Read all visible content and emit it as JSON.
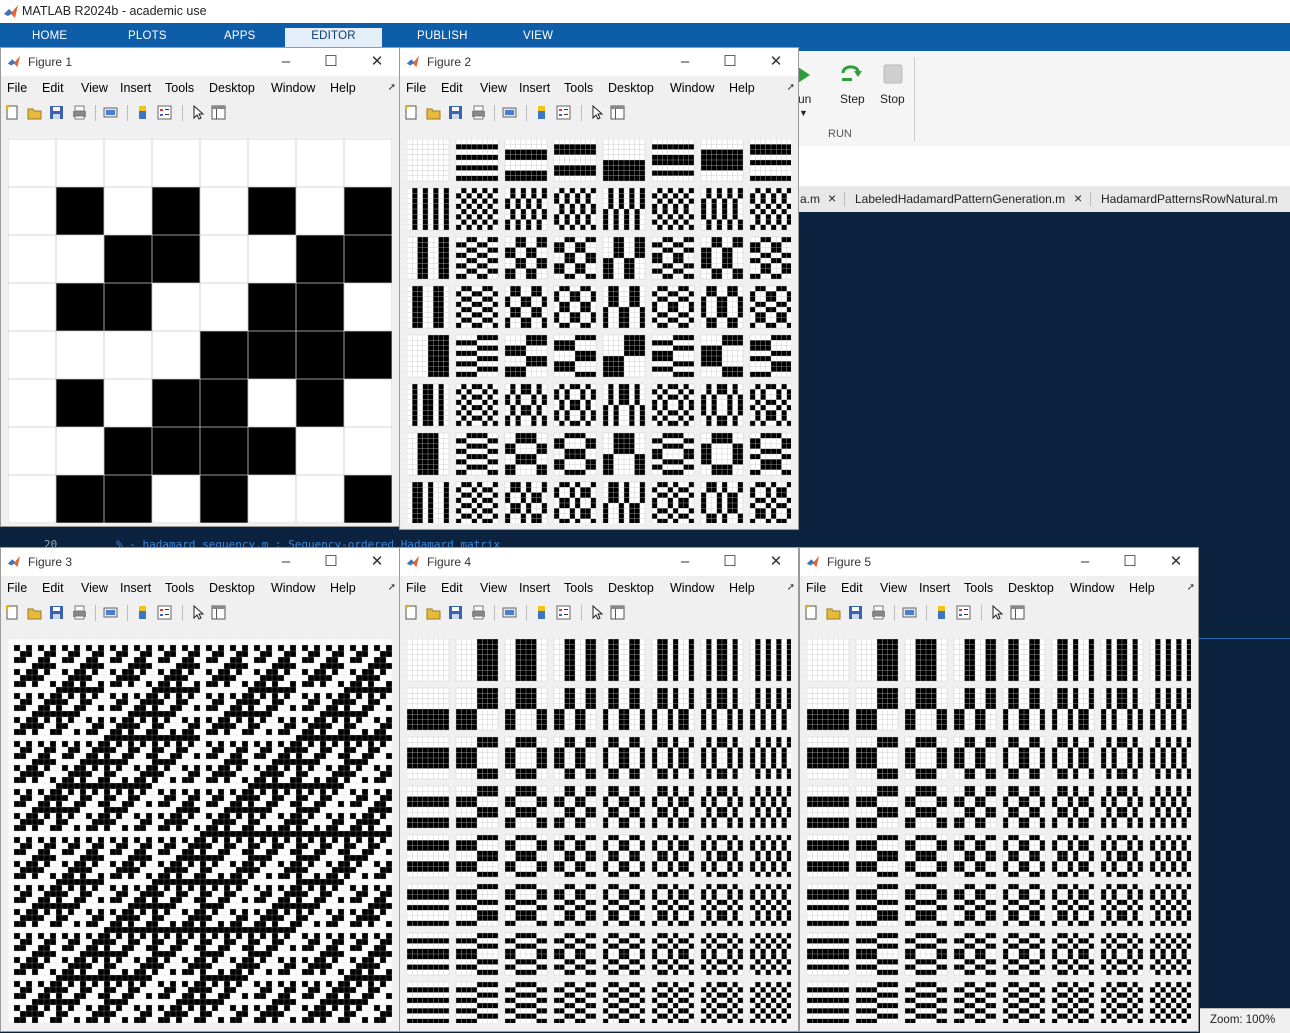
{
  "app": {
    "title": "MATLAB R2024b - academic use",
    "tabs": [
      "HOME",
      "PLOTS",
      "APPS",
      "EDITOR",
      "PUBLISH",
      "VIEW"
    ],
    "active_tab": "EDITOR"
  },
  "ribbon": {
    "run_label": "un",
    "step_label": "Step",
    "stop_label": "Stop",
    "section_label": "RUN"
  },
  "editor": {
    "file_tabs": [
      "a.m",
      "LabeledHadamardPatternGeneration.m",
      "HadamardPatternsRowNatural.m"
    ],
    "close_glyph": "×",
    "line_number": "20",
    "code_line": "%   - hadamard_sequency.m   : Sequency-ordered Hadamard matrix"
  },
  "status": {
    "zoom": "Zoom: 100%"
  },
  "figure_menu": [
    "File",
    "Edit",
    "View",
    "Insert",
    "Tools",
    "Desktop",
    "Window",
    "Help"
  ],
  "figures": [
    {
      "title": "Figure 1",
      "kind": "matrix8"
    },
    {
      "title": "Figure 2",
      "kind": "grid",
      "order": "natural_wh"
    },
    {
      "title": "Figure 3",
      "kind": "matrix64"
    },
    {
      "title": "Figure 4",
      "kind": "grid",
      "order": "sequency"
    },
    {
      "title": "Figure 5",
      "kind": "grid",
      "order": "sequency"
    }
  ],
  "colors": {
    "accent": "#0e5da8",
    "editor_bg": "#0c2340"
  }
}
